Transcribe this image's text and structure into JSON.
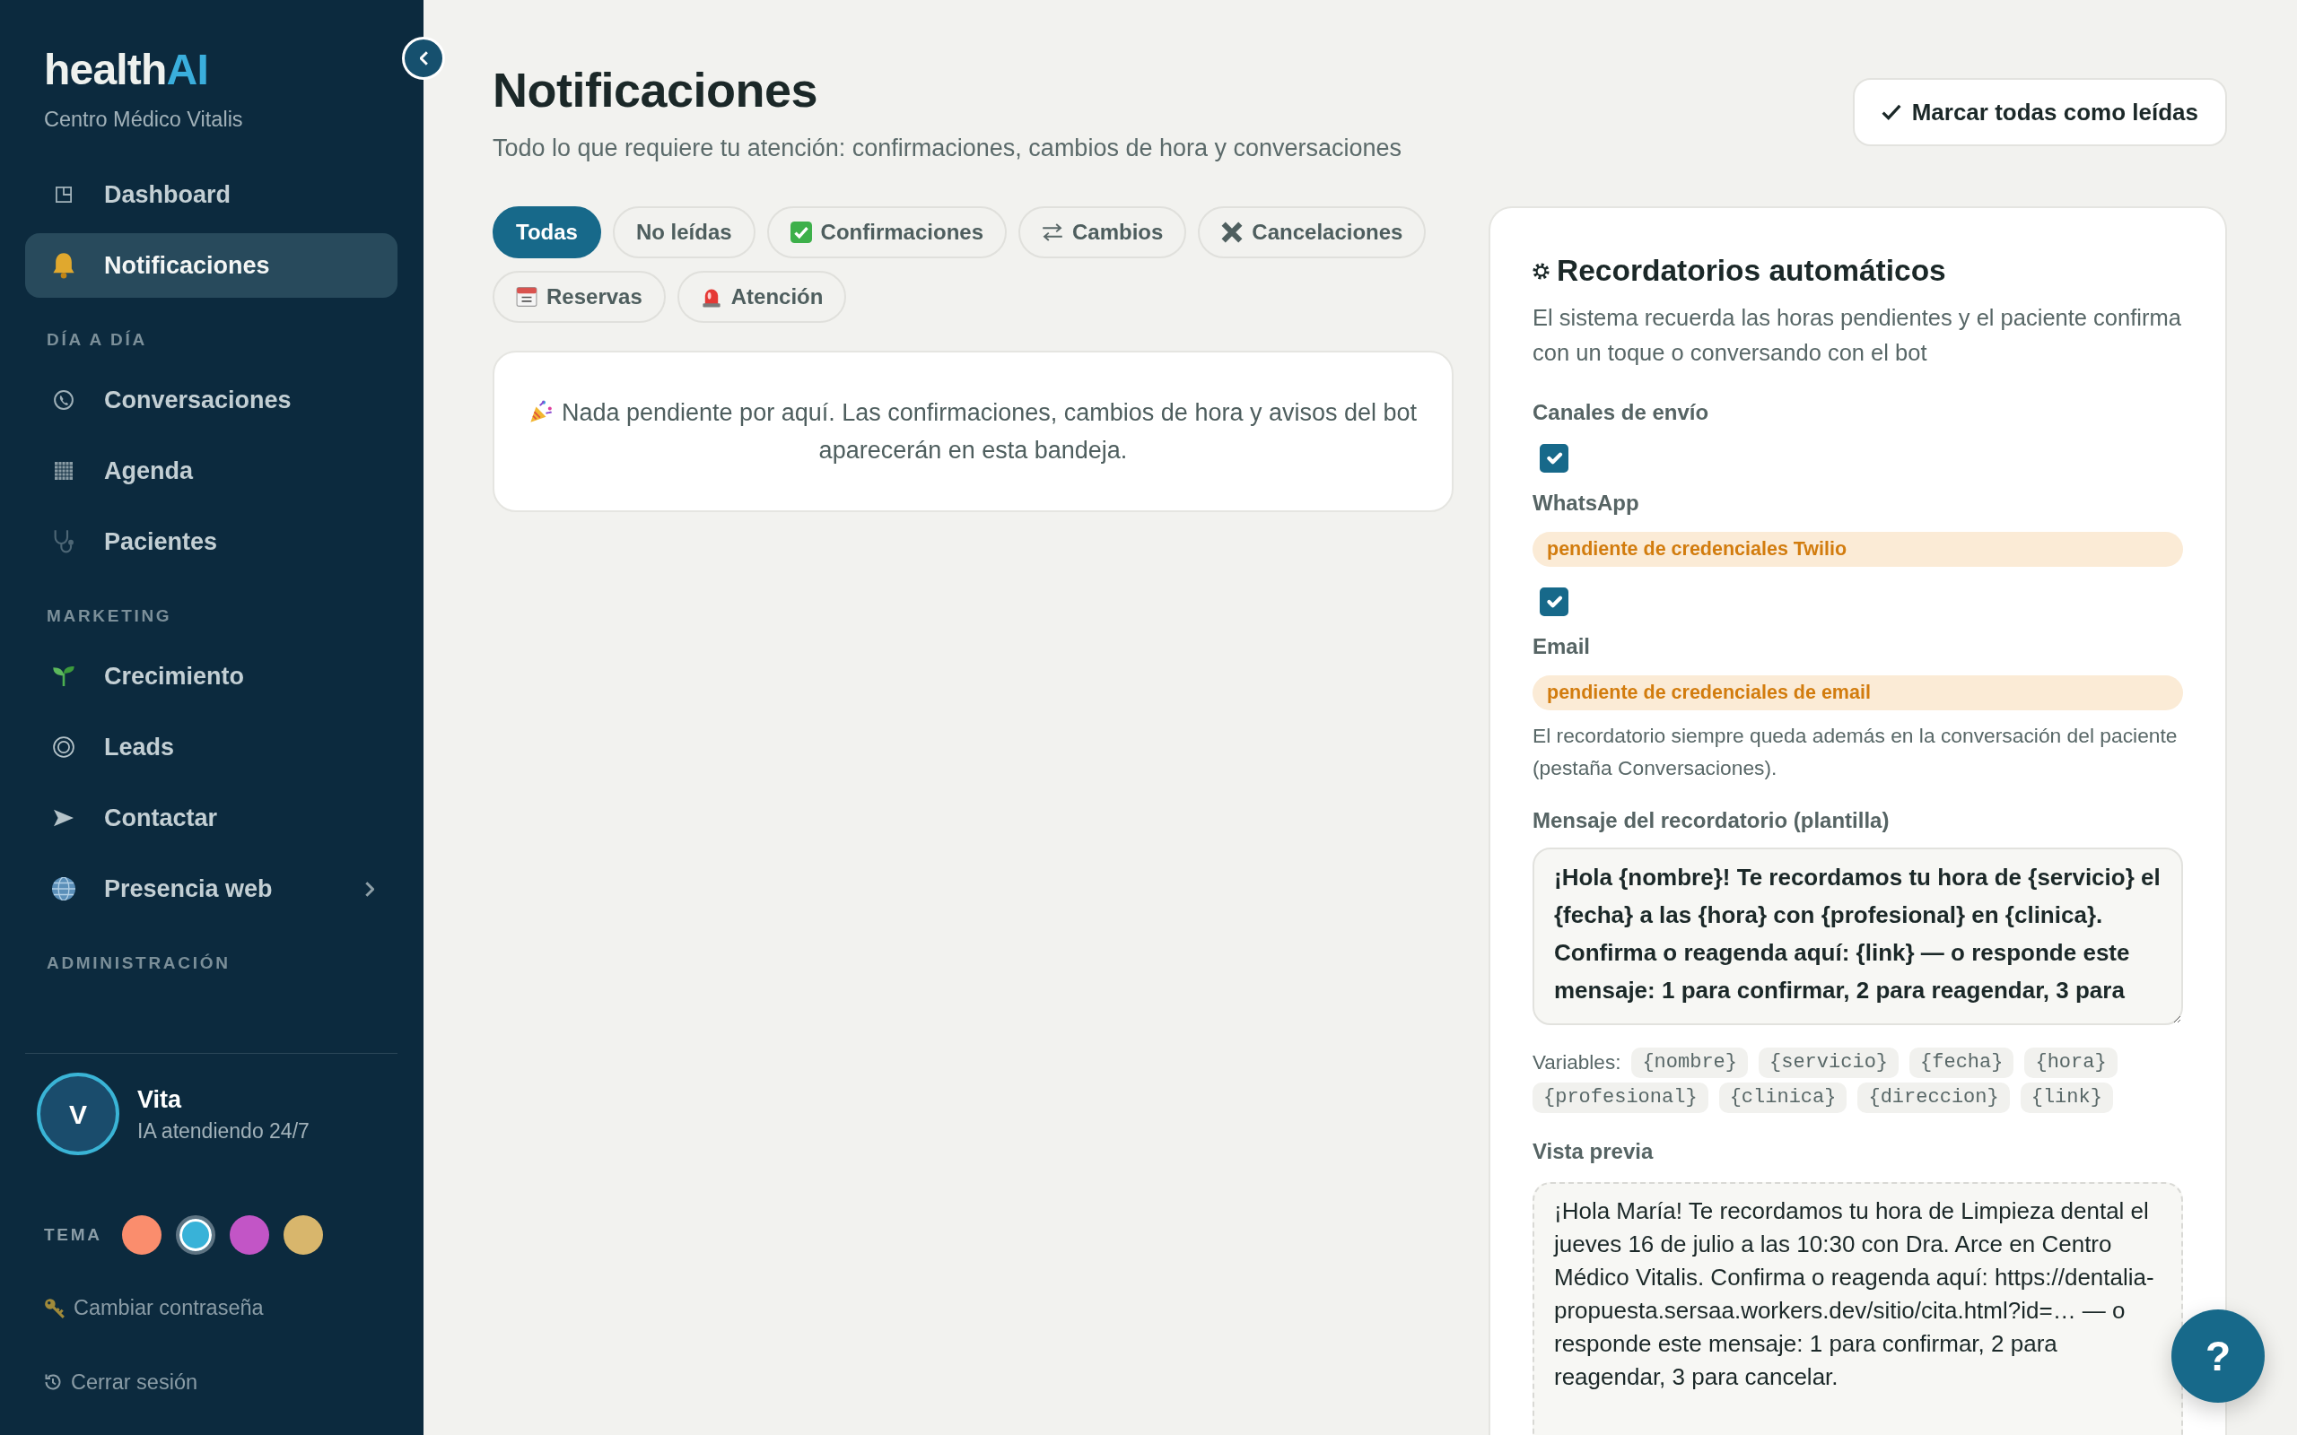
{
  "sidebar": {
    "logo": {
      "text": "health",
      "accent": "AI"
    },
    "clinic": "Centro Médico Vitalis",
    "nav": [
      {
        "kind": "link",
        "label": "Dashboard",
        "selected": false,
        "expandable": false
      },
      {
        "kind": "link",
        "label": "Notificaciones",
        "selected": true,
        "expandable": false
      },
      {
        "kind": "heading",
        "label": "DÍA A DÍA"
      },
      {
        "kind": "link",
        "label": "Conversaciones",
        "selected": false,
        "expandable": false
      },
      {
        "kind": "link",
        "label": "Agenda",
        "selected": false,
        "expandable": false
      },
      {
        "kind": "link",
        "label": "Pacientes",
        "selected": false,
        "expandable": false
      },
      {
        "kind": "heading",
        "label": "MARKETING"
      },
      {
        "kind": "link",
        "label": "Crecimiento",
        "selected": false,
        "expandable": false
      },
      {
        "kind": "link",
        "label": "Leads",
        "selected": false,
        "expandable": false
      },
      {
        "kind": "link",
        "label": "Contactar",
        "selected": false,
        "expandable": false
      },
      {
        "kind": "link",
        "label": "Presencia web",
        "selected": false,
        "expandable": true
      },
      {
        "kind": "heading",
        "label": "ADMINISTRACIÓN"
      }
    ],
    "assistant": {
      "initial": "V",
      "name": "Vita",
      "status": "IA atendiendo 24/7"
    },
    "theme": {
      "label": "TEMA",
      "swatches": [
        {
          "color": "#fa8d6d",
          "selected": false
        },
        {
          "color": "#38b2d8",
          "selected": true
        },
        {
          "color": "#c255c6",
          "selected": false
        },
        {
          "color": "#d8b66c",
          "selected": false
        }
      ]
    },
    "account_links": [
      "Cambiar contraseña",
      "Cerrar sesión"
    ]
  },
  "header": {
    "title": "Notificaciones",
    "subtitle": "Todo lo que requiere tu atención: confirmaciones, cambios de hora y conversaciones",
    "mark_all_button": "Marcar todas como leídas"
  },
  "filters": [
    {
      "label": "Todas",
      "selected": true
    },
    {
      "label": "No leídas",
      "selected": false
    },
    {
      "label": "Confirmaciones",
      "selected": false
    },
    {
      "label": "Cambios",
      "selected": false
    },
    {
      "label": "Cancelaciones",
      "selected": false
    },
    {
      "label": "Reservas",
      "selected": false
    },
    {
      "label": "Atención",
      "selected": false
    }
  ],
  "empty_state": "Nada pendiente por aquí. Las confirmaciones, cambios de hora y avisos del bot aparecerán en esta bandeja.",
  "reminders": {
    "title": "Recordatorios automáticos",
    "description": "El sistema recuerda las horas pendientes y el paciente confirma con un toque o conversando con el bot",
    "channels_label": "Canales de envío",
    "channels": [
      {
        "name": "WhatsApp",
        "checked": true,
        "status": "pendiente de credenciales Twilio"
      },
      {
        "name": "Email",
        "checked": true,
        "status": "pendiente de credenciales de email"
      }
    ],
    "note": "El recordatorio siempre queda además en la conversación del paciente (pestaña Conversaciones).",
    "template_label": "Mensaje del recordatorio (plantilla)",
    "template": "¡Hola {nombre}! Te recordamos tu hora de {servicio} el {fecha} a las {hora} con {profesional} en {clinica}. Confirma o reagenda aquí: {link} — o responde este mensaje: 1 para confirmar, 2 para reagendar, 3 para",
    "variables_label": "Variables:",
    "variables": [
      "{nombre}",
      "{servicio}",
      "{fecha}",
      "{hora}",
      "{profesional}",
      "{clinica}",
      "{direccion}",
      "{link}"
    ],
    "preview_label": "Vista previa",
    "preview": "¡Hola María! Te recordamos tu hora de Limpieza dental el jueves 16 de julio a las 10:30 con Dra. Arce en Centro Médico Vitalis. Confirma o reagenda aquí: https://dentalia-propuesta.sersaa.workers.dev/sitio/cita.html?id=… — o responde este mensaje: 1 para confirmar, 2 para reagendar, 3 para cancelar."
  },
  "help_button": "?"
}
